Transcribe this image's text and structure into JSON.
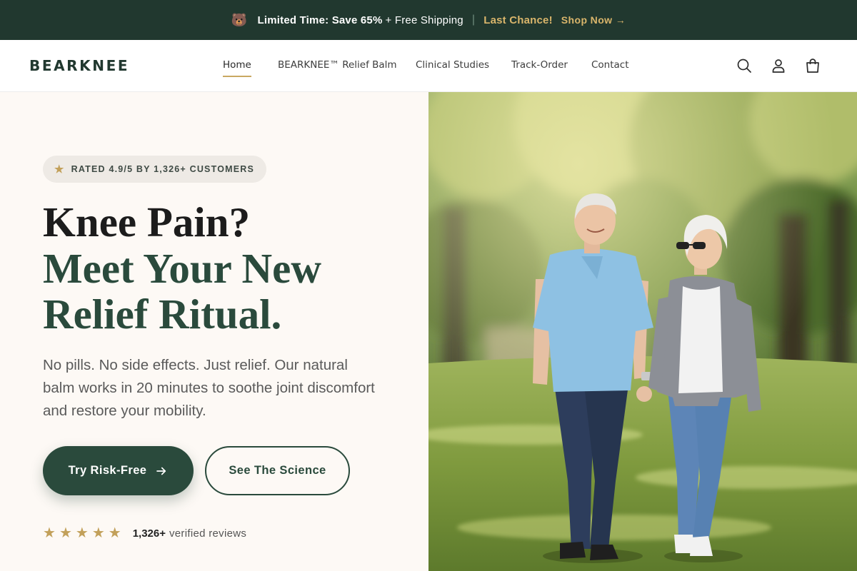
{
  "announcement": {
    "icon": "bear-icon",
    "icon_glyph": "🐻",
    "strong_text": "Limited Time: Save 65%",
    "plain_text": "+ Free Shipping",
    "separator": "|",
    "last_chance": "Last Chance!",
    "shop_now": "Shop Now →"
  },
  "header": {
    "logo": "BEARKNEE",
    "nav": [
      {
        "label": "Home",
        "active": true
      },
      {
        "label": "BEARKNEE™ Relief Balm"
      },
      {
        "label": "Clinical Studies"
      },
      {
        "label": "Track-Order"
      },
      {
        "label": "Contact"
      }
    ],
    "icons": [
      "search-icon",
      "account-icon",
      "cart-icon"
    ]
  },
  "hero": {
    "rating_badge": "RATED 4.9/5 BY 1,326+ CUSTOMERS",
    "headline_line1": "Knee Pain?",
    "headline_line2": "Meet Your New",
    "headline_line3": "Relief Ritual.",
    "subtext": "No pills. No side effects. Just relief. Our natural balm works in 20 minutes to soothe joint discomfort and restore your mobility.",
    "cta_primary": "Try Risk-Free",
    "cta_secondary": "See The Science",
    "review_stars": 5,
    "review_count": "1,326+",
    "review_label": "verified reviews",
    "image_alt": "Senior couple walking hand in hand through a sunny park"
  },
  "colors": {
    "brand_green": "#21382f",
    "accent_gold": "#c9a862",
    "button_green": "#2a4a3c",
    "page_bg": "#fdf9f5"
  }
}
